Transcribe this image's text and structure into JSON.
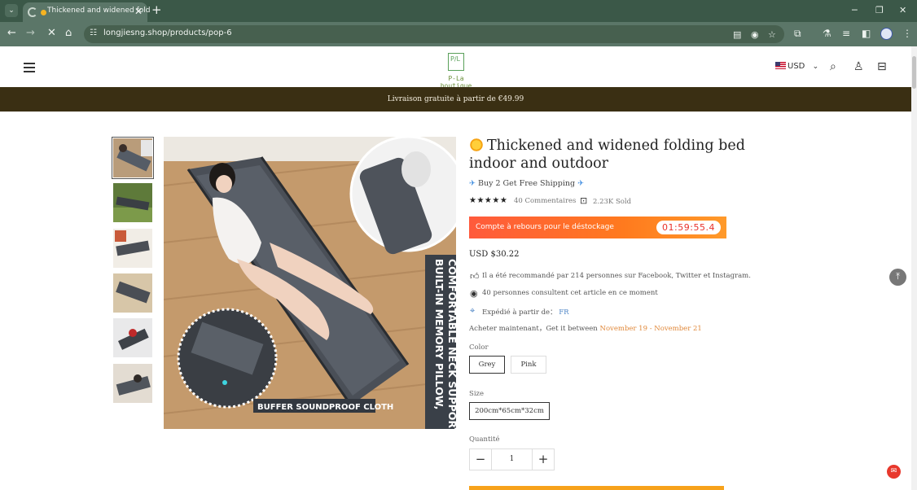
{
  "browser": {
    "tab_title": "Thickened and widened fold",
    "url": "longjiesng.shop/products/pop-6",
    "new_tab_label": "+",
    "tab_close_label": "✕"
  },
  "site": {
    "logo_text": "P-La boutique",
    "currency": "USD",
    "banner": "Livraison gratuite à partir de €49.99"
  },
  "gallery": {
    "main_caption_bottom": "BUFFER SOUNDPROOF CLOTH",
    "main_caption_side_1": "BUILT-IN MEMORY PILLOW,",
    "main_caption_side_2": "COMFORTABLE NECK SUPPORT",
    "thumb_count": 6
  },
  "product": {
    "title": "Thickened and widened folding bed indoor and outdoor",
    "promo": "Buy 2 Get Free Shipping",
    "rating": 5,
    "reviews": "40 Commentaires",
    "sold": "2.23K Sold",
    "countdown_label": "Compte à rebours pour le déstockage",
    "countdown_timer": "01:59:55.4",
    "price": "USD $30.22",
    "recommend": "Il a été recommandé par 214 personnes sur Facebook, Twitter et Instagram.",
    "viewing": "40 personnes consultent cet article en ce moment",
    "ship_from_label": "Expédié à partir de：",
    "ship_from_value": "FR",
    "deliver_prefix": "Acheter maintenant，Get it between",
    "deliver_dates": "November 19 - November 21",
    "color_label": "Color",
    "color_options": [
      "Grey",
      "Pink"
    ],
    "selected_color": "Grey",
    "size_label": "Size",
    "size_options": [
      "200cm*65cm*32cm"
    ],
    "qty_label": "Quantité",
    "qty_value": "1"
  },
  "colors": {
    "tab_bar": "#3b5848",
    "address_bar": "#5b7668",
    "banner": "#3a2f13",
    "countdown_start": "#ff5a3c",
    "countdown_end": "#ff9a2a",
    "accent_date": "#e0883a"
  }
}
